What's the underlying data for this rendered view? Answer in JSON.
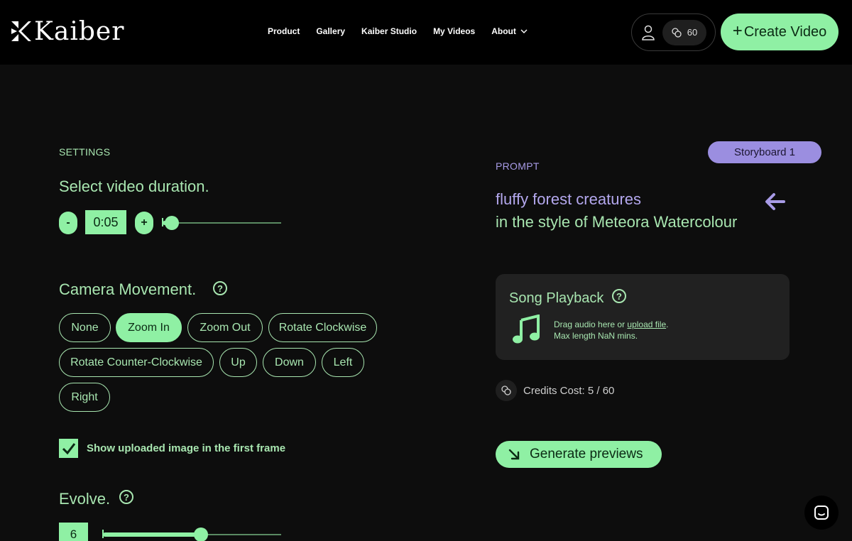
{
  "header": {
    "logo_text": "Kaiber",
    "nav": [
      {
        "label": "Product"
      },
      {
        "label": "Gallery"
      },
      {
        "label": "Kaiber Studio"
      },
      {
        "label": "My Videos"
      },
      {
        "label": "About"
      }
    ],
    "credits": "60",
    "create_label": "Create Video"
  },
  "settings": {
    "section_label": "SETTINGS",
    "duration_heading": "Select video duration.",
    "minus": "-",
    "plus": "+",
    "duration_value": "0:05",
    "camera_heading": "Camera Movement.",
    "chips": [
      {
        "label": "None",
        "active": false
      },
      {
        "label": "Zoom In",
        "active": true
      },
      {
        "label": "Zoom Out",
        "active": false
      },
      {
        "label": "Rotate Clockwise",
        "active": false
      },
      {
        "label": "Rotate Counter-Clockwise",
        "active": false
      },
      {
        "label": "Up",
        "active": false
      },
      {
        "label": "Down",
        "active": false
      },
      {
        "label": "Left",
        "active": false
      },
      {
        "label": "Right",
        "active": false
      }
    ],
    "checkbox_label": "Show uploaded image in the first frame",
    "checkbox_checked": true,
    "evolve_heading": "Evolve.",
    "evolve_value": "6",
    "help_glyph": "?"
  },
  "prompt": {
    "storyboard_label": "Storyboard 1",
    "label": "PROMPT",
    "line1": "fluffy forest creatures",
    "line2": "in the style of Meteora Watercolour"
  },
  "song": {
    "title": "Song Playback",
    "drag_text": "Drag audio here or",
    "upload_link": "upload file",
    "period": ".",
    "max_text": "Max length NaN mins."
  },
  "credits_cost": "Credits Cost: 5 / 60",
  "generate_label": "Generate previews",
  "colors": {
    "accent_green": "#8ff0a4",
    "text_green": "#a8e6b0",
    "purple": "#9b8ee0",
    "background": "#0d0d0d"
  }
}
